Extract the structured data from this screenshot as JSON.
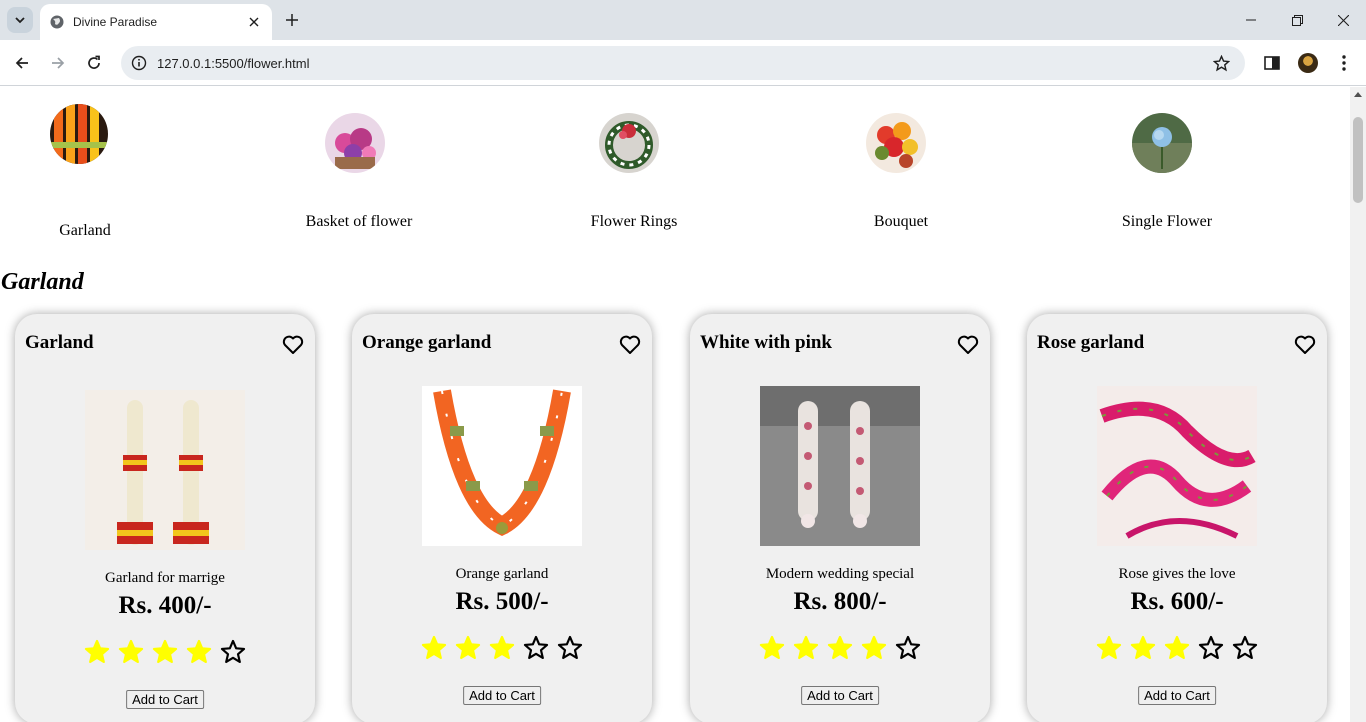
{
  "browser": {
    "tab_title": "Divine Paradise",
    "url": "127.0.0.1:5500/flower.html"
  },
  "categories": [
    {
      "label": "Garland",
      "icon": "garland-thumbnail"
    },
    {
      "label": "Basket of flower",
      "icon": "basket-thumbnail"
    },
    {
      "label": "Flower Rings",
      "icon": "flower-ring-thumbnail"
    },
    {
      "label": "Bouquet",
      "icon": "bouquet-thumbnail"
    },
    {
      "label": "Single Flower",
      "icon": "single-flower-thumbnail"
    }
  ],
  "section_title": "Garland",
  "products": [
    {
      "title": "Garland",
      "description": "Garland for marrige",
      "price": "Rs. 400/-",
      "rating": 4,
      "button": "Add to Cart"
    },
    {
      "title": "Orange garland",
      "description": "Orange garland",
      "price": "Rs. 500/-",
      "rating": 3,
      "button": "Add to Cart"
    },
    {
      "title": "White with pink",
      "description": "Modern wedding special",
      "price": "Rs. 800/-",
      "rating": 4,
      "button": "Add to Cart"
    },
    {
      "title": "Rose garland",
      "description": "Rose gives the love",
      "price": "Rs. 600/-",
      "rating": 3,
      "button": "Add to Cart"
    }
  ],
  "colors": {
    "star_filled": "#ffff00",
    "star_outline": "#000000",
    "card_bg": "#f0f0f0"
  }
}
